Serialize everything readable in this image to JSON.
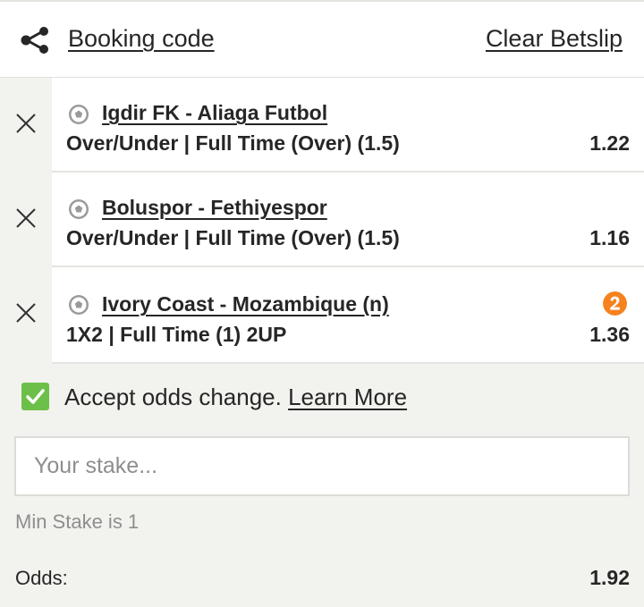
{
  "header": {
    "share_icon": "share-icon",
    "booking_label": "Booking code",
    "clear_label": "Clear Betslip"
  },
  "bets": [
    {
      "teams": "Igdir FK - Aliaga Futbol",
      "market": "Over/Under | Full Time (Over) (1.5)",
      "odd": "1.22",
      "sport_icon": "soccer-ball-icon",
      "remove_icon": "close-icon"
    },
    {
      "teams": "Boluspor - Fethiyespor",
      "market": "Over/Under | Full Time (Over) (1.5)",
      "odd": "1.16",
      "sport_icon": "soccer-ball-icon",
      "remove_icon": "close-icon"
    },
    {
      "teams": "Ivory Coast - Mozambique (n)",
      "market": "1X2 | Full Time (1) 2UP",
      "odd": "1.36",
      "sport_icon": "soccer-ball-icon",
      "remove_icon": "close-icon",
      "badge_icon": "2up-badge-icon",
      "badge_color": "#f5821f"
    }
  ],
  "accept": {
    "checked": true,
    "label": "Accept odds change.",
    "learn_more": "Learn More",
    "check_color": "#6cc04a"
  },
  "stake": {
    "placeholder": "Your stake...",
    "value": "",
    "min_stake_text": "Min Stake is 1"
  },
  "summary": {
    "odds_label": "Odds:",
    "odds_value": "1.92"
  }
}
